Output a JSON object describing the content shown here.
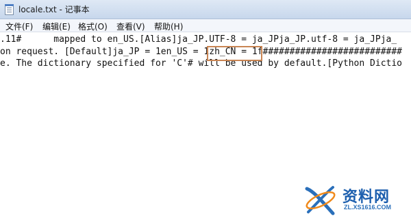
{
  "window": {
    "title": "locale.txt - 记事本"
  },
  "menu": [
    "文件(F)",
    "编辑(E)",
    "格式(O)",
    "查看(V)",
    "帮助(H)"
  ],
  "editor": {
    "lines": [
      ".11#      mapped to en_US.[Alias]ja_JP.UTF-8 = ja_JPja_JP.utf-8 = ja_JPja_",
      "on request. [Default]ja_JP = 1en_US = 1zh_CN = 1f##########################",
      "e. The dictionary specified for 'C'# will be used by default.[Python Dictio"
    ],
    "highlighted_text": "1zh_CN = 1"
  },
  "watermark": {
    "title": "资料网",
    "url": "ZL.XS1616.COM"
  },
  "colors": {
    "highlight_border": "#c98553",
    "watermark_blue": "#1d5fae",
    "watermark_orange": "#f08a1c"
  }
}
